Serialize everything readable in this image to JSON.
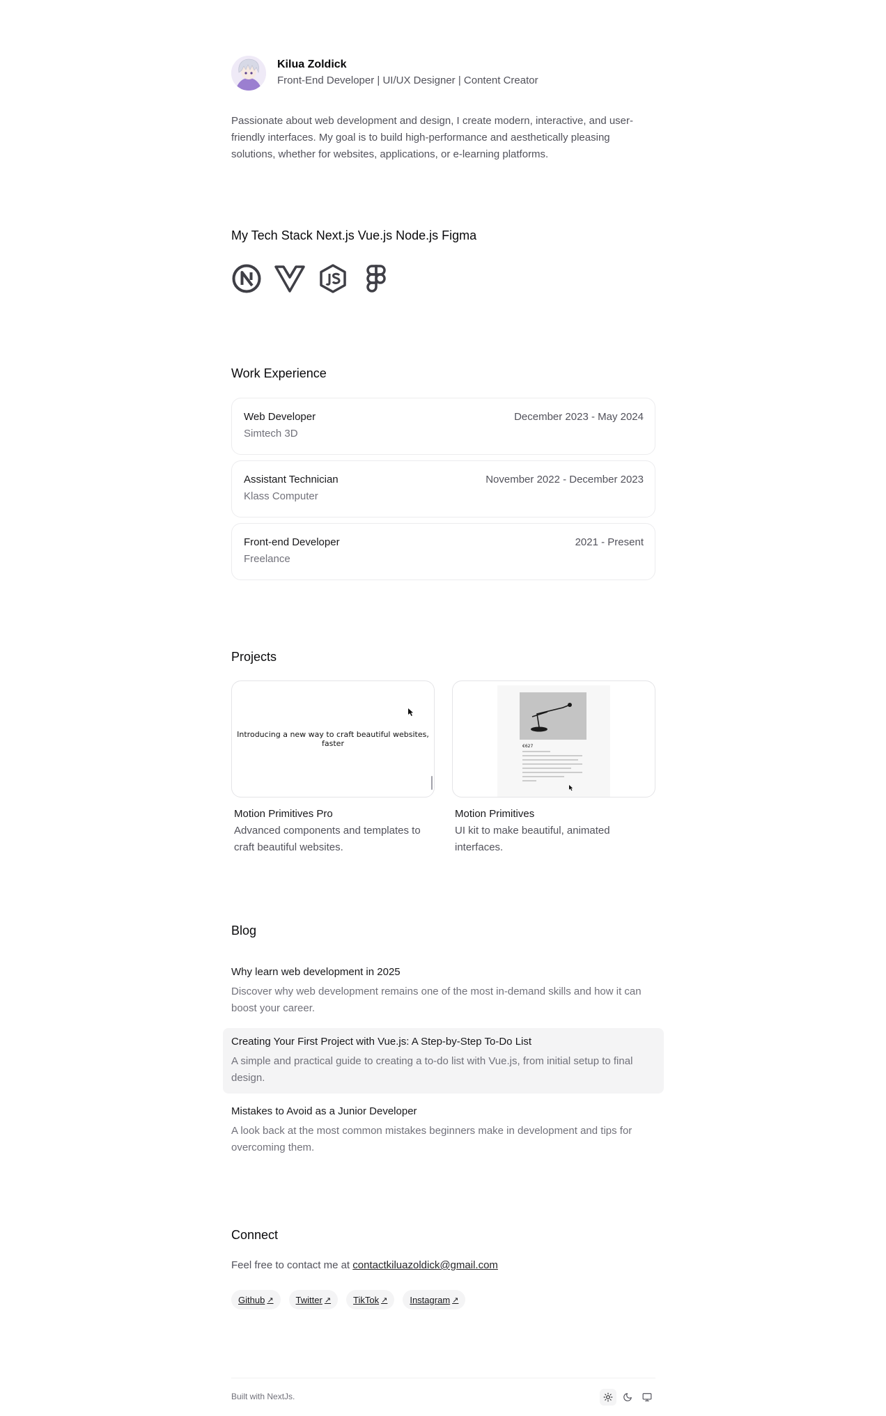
{
  "profile": {
    "name": "Kilua Zoldick",
    "role": "Front-End Developer | UI/UX Designer | Content Creator",
    "intro": "Passionate about web development and design, I create modern, interactive, and user-friendly interfaces. My goal is to build high-performance and aesthetically pleasing solutions, whether for websites, applications, or e-learning platforms."
  },
  "tech": {
    "title": "My Tech Stack Next.js Vue.js Node.js Figma",
    "icons": [
      "nextjs-icon",
      "vuejs-icon",
      "nodejs-icon",
      "figma-icon"
    ]
  },
  "experience": {
    "title": "Work Experience",
    "items": [
      {
        "title": "Web Developer",
        "company": "Simtech 3D",
        "date": "December 2023 - May 2024"
      },
      {
        "title": "Assistant Technician",
        "company": "Klass Computer",
        "date": "November 2022 - December 2023"
      },
      {
        "title": "Front-end Developer",
        "company": "Freelance",
        "date": "2021 - Present"
      }
    ]
  },
  "projects": {
    "title": "Projects",
    "items": [
      {
        "title": "Motion Primitives Pro",
        "desc": "Advanced components and templates to craft beautiful websites.",
        "preview_text": "Introducing a new way to craft beautiful websites, faster"
      },
      {
        "title": "Motion Primitives",
        "desc": "UI kit to make beautiful, animated interfaces.",
        "preview_label": "€627"
      }
    ]
  },
  "blog": {
    "title": "Blog",
    "items": [
      {
        "title": "Why learn web development in 2025",
        "desc": "Discover why web development remains one of the most in-demand skills and how it can boost your career."
      },
      {
        "title": "Creating Your First Project with Vue.js: A Step-by-Step To-Do List",
        "desc": "A simple and practical guide to creating a to-do list with Vue.js, from initial setup to final design."
      },
      {
        "title": "Mistakes to Avoid as a Junior Developer",
        "desc": "A look back at the most common mistakes beginners make in development and tips for overcoming them."
      }
    ]
  },
  "connect": {
    "title": "Connect",
    "text": "Feel free to contact me at",
    "email": "contactkiluazoldick@gmail.com",
    "socials": [
      "Github",
      "Twitter",
      "TikTok",
      "Instagram"
    ],
    "arrow": "↗"
  },
  "footer": {
    "built": "Built with NextJs.",
    "theme_icons": [
      "sun-icon",
      "moon-icon",
      "monitor-icon"
    ]
  }
}
